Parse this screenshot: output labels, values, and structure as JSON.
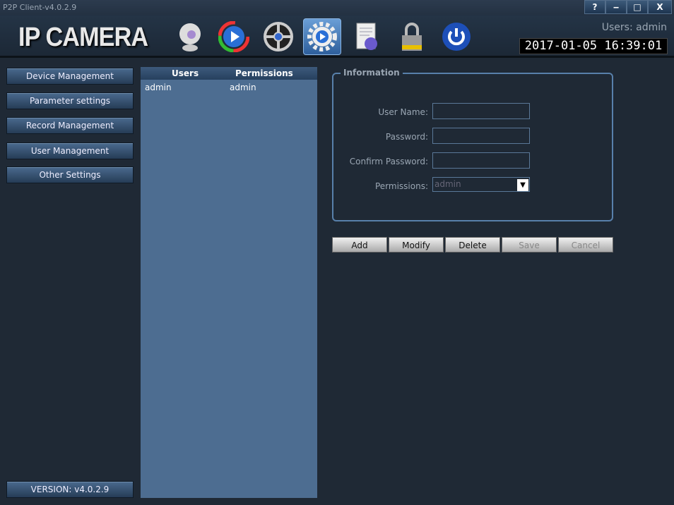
{
  "window": {
    "title": "P2P Client-v4.0.2.9",
    "help": "?",
    "minimize": "‒",
    "maximize": "□",
    "close": "X"
  },
  "header": {
    "logo": "IP CAMERA",
    "users_label": "Users: admin",
    "datetime": "2017-01-05 16:39:01",
    "toolbar": [
      {
        "icon": "webcam-icon"
      },
      {
        "icon": "playback-icon"
      },
      {
        "icon": "ptz-wheel-icon"
      },
      {
        "icon": "settings-gear-icon",
        "active": true
      },
      {
        "icon": "log-document-icon"
      },
      {
        "icon": "lock-icon"
      },
      {
        "icon": "power-icon"
      }
    ]
  },
  "sidebar": {
    "items": [
      {
        "label": "Device Management"
      },
      {
        "label": "Parameter settings"
      },
      {
        "label": "Record Management"
      },
      {
        "label": "User Management"
      },
      {
        "label": "Other Settings"
      }
    ],
    "version": "VERSION: v4.0.2.9"
  },
  "user_list": {
    "columns": [
      "Users",
      "Permissions"
    ],
    "rows": [
      {
        "user": "admin",
        "permission": "admin"
      }
    ]
  },
  "info": {
    "title": "Information",
    "user_name_label": "User Name:",
    "user_name": "",
    "password_label": "Password:",
    "password": "",
    "confirm_label": "Confirm Password:",
    "confirm": "",
    "permissions_label": "Permissions:",
    "permissions": "admin"
  },
  "actions": {
    "add": "Add",
    "modify": "Modify",
    "delete": "Delete",
    "save": "Save",
    "cancel": "Cancel"
  }
}
